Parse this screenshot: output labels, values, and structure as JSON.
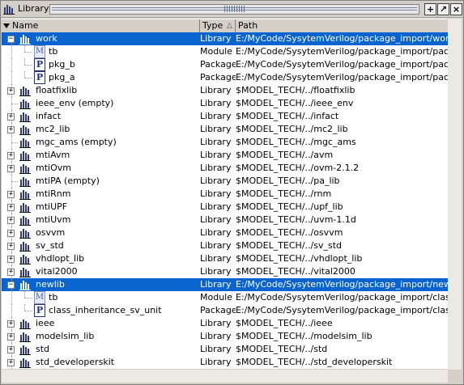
{
  "window": {
    "title": "Library",
    "buttons": [
      "+",
      "↗",
      "×"
    ]
  },
  "header": {
    "sort_icon": "sort-down-icon",
    "name": "Name",
    "type": "Type",
    "type_sort": "△",
    "path": "Path"
  },
  "rows": [
    {
      "name": "work",
      "type": "Library",
      "path": "E:/MyCode/SysytemVerilog/package_import/work",
      "icon": "library-icon",
      "expander": "−",
      "level": 0,
      "selected": true
    },
    {
      "name": "tb",
      "type": "Module",
      "path": "E:/MyCode/SysytemVerilog/package_import/package_",
      "icon": "module-icon",
      "level": 1
    },
    {
      "name": "pkg_b",
      "type": "Package",
      "path": "E:/MyCode/SysytemVerilog/package_import/package_",
      "icon": "package-icon",
      "level": 1
    },
    {
      "name": "pkg_a",
      "type": "Package",
      "path": "E:/MyCode/SysytemVerilog/package_import/package_",
      "icon": "package-icon",
      "level": 1
    },
    {
      "name": "floatfixlib",
      "type": "Library",
      "path": "$MODEL_TECH/../floatfixlib",
      "icon": "library-icon",
      "expander": "+",
      "level": 0
    },
    {
      "name": "ieee_env  (empty)",
      "type": "Library",
      "path": "$MODEL_TECH/../ieee_env",
      "icon": "library-icon",
      "level": 0
    },
    {
      "name": "infact",
      "type": "Library",
      "path": "$MODEL_TECH/../infact",
      "icon": "library-icon",
      "expander": "+",
      "level": 0
    },
    {
      "name": "mc2_lib",
      "type": "Library",
      "path": "$MODEL_TECH/../mc2_lib",
      "icon": "library-icon",
      "expander": "+",
      "level": 0
    },
    {
      "name": "mgc_ams  (empty)",
      "type": "Library",
      "path": "$MODEL_TECH/../mgc_ams",
      "icon": "library-icon",
      "level": 0
    },
    {
      "name": "mtiAvm",
      "type": "Library",
      "path": "$MODEL_TECH/../avm",
      "icon": "library-icon",
      "expander": "+",
      "level": 0
    },
    {
      "name": "mtiOvm",
      "type": "Library",
      "path": "$MODEL_TECH/../ovm-2.1.2",
      "icon": "library-icon",
      "expander": "+",
      "level": 0
    },
    {
      "name": "mtiPA  (empty)",
      "type": "Library",
      "path": "$MODEL_TECH/../pa_lib",
      "icon": "library-icon",
      "level": 0
    },
    {
      "name": "mtiRnm",
      "type": "Library",
      "path": "$MODEL_TECH/../rnm",
      "icon": "library-icon",
      "expander": "+",
      "level": 0
    },
    {
      "name": "mtiUPF",
      "type": "Library",
      "path": "$MODEL_TECH/../upf_lib",
      "icon": "library-icon",
      "expander": "+",
      "level": 0
    },
    {
      "name": "mtiUvm",
      "type": "Library",
      "path": "$MODEL_TECH/../uvm-1.1d",
      "icon": "library-icon",
      "expander": "+",
      "level": 0
    },
    {
      "name": "osvvm",
      "type": "Library",
      "path": "$MODEL_TECH/../osvvm",
      "icon": "library-icon",
      "expander": "+",
      "level": 0
    },
    {
      "name": "sv_std",
      "type": "Library",
      "path": "$MODEL_TECH/../sv_std",
      "icon": "library-icon",
      "expander": "+",
      "level": 0
    },
    {
      "name": "vhdlopt_lib",
      "type": "Library",
      "path": "$MODEL_TECH/../vhdlopt_lib",
      "icon": "library-icon",
      "expander": "+",
      "level": 0
    },
    {
      "name": "vital2000",
      "type": "Library",
      "path": "$MODEL_TECH/../vital2000",
      "icon": "library-icon",
      "expander": "+",
      "level": 0
    },
    {
      "name": "newlib",
      "type": "Library",
      "path": "E:/MyCode/SysytemVerilog/package_import/newlib",
      "icon": "library-icon",
      "expander": "−",
      "level": 0,
      "selected": true
    },
    {
      "name": "tb",
      "type": "Module",
      "path": "E:/MyCode/SysytemVerilog/package_import/class_inhe",
      "icon": "module-icon",
      "level": 1
    },
    {
      "name": "class_inheritance_sv_unit",
      "type": "Package",
      "path": "E:/MyCode/SysytemVerilog/package_import/class_inhe",
      "icon": "package-icon",
      "level": 1
    },
    {
      "name": "ieee",
      "type": "Library",
      "path": "$MODEL_TECH/../ieee",
      "icon": "library-icon",
      "expander": "+",
      "level": 0
    },
    {
      "name": "modelsim_lib",
      "type": "Library",
      "path": "$MODEL_TECH/../modelsim_lib",
      "icon": "library-icon",
      "expander": "+",
      "level": 0
    },
    {
      "name": "std",
      "type": "Library",
      "path": "$MODEL_TECH/../std",
      "icon": "library-icon",
      "expander": "+",
      "level": 0
    },
    {
      "name": "std_developerskit",
      "type": "Library",
      "path": "$MODEL_TECH/../std_developerskit",
      "icon": "library-icon",
      "expander": "+",
      "level": 0
    }
  ],
  "icons": {
    "module_glyph": "M",
    "package_glyph": "P"
  },
  "colors": {
    "selection": "#0a64d0",
    "selection_text": "#ffffff"
  }
}
